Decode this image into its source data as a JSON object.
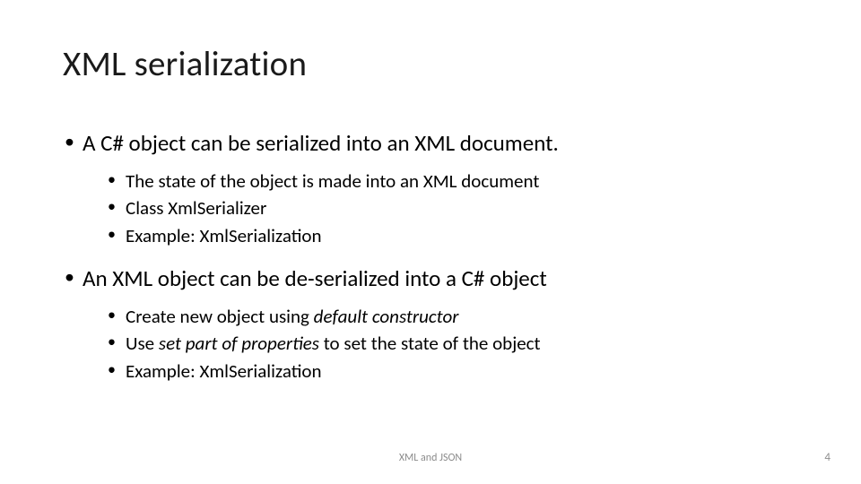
{
  "title": "XML serialization",
  "bullets": [
    {
      "text": "A C# object can be serialized into an XML document.",
      "sub": [
        {
          "text": "The state of the object is made into an XML document"
        },
        {
          "text": "Class XmlSerializer"
        },
        {
          "text": "Example: XmlSerialization"
        }
      ]
    },
    {
      "text": "An XML object can be de-serialized into a C# object",
      "sub": [
        {
          "prefix": "Create new object using ",
          "em": "default constructor",
          "suffix": ""
        },
        {
          "prefix": "Use ",
          "em": "set part of properties",
          "suffix": " to set the state of the object"
        },
        {
          "text": "Example: XmlSerialization"
        }
      ]
    }
  ],
  "footer": {
    "label": "XML and JSON"
  },
  "page_number": "4"
}
